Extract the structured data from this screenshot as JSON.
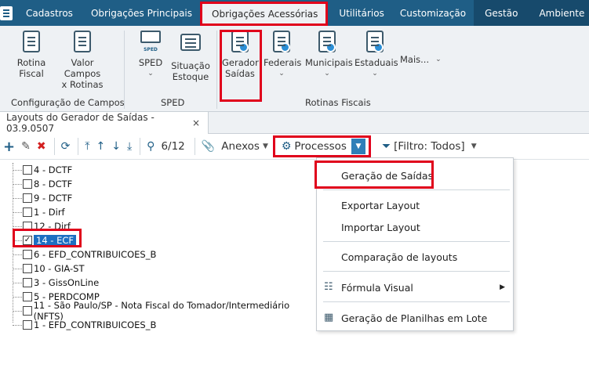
{
  "menubar": {
    "tabs": [
      {
        "label": "Cadastros"
      },
      {
        "label": "Obrigações Principais"
      },
      {
        "label": "Obrigações Acessórias"
      },
      {
        "label": "Utilitários"
      },
      {
        "label": "Customização"
      },
      {
        "label": "Gestão"
      },
      {
        "label": "Ambiente"
      }
    ]
  },
  "ribbon": {
    "buttons": [
      {
        "label": "Rotina\nFiscal",
        "line1": "Rotina",
        "line2": "Fiscal"
      },
      {
        "label": "Valor Campos x Rotinas",
        "line1": "Valor Campos",
        "line2": "x Rotinas"
      },
      {
        "label": "SPED",
        "line1": "SPED",
        "line2": ""
      },
      {
        "label": "Situação Estoque",
        "line1": "Situação",
        "line2": "Estoque"
      },
      {
        "label": "Gerador Saídas",
        "line1": "Gerador",
        "line2": "Saídas"
      },
      {
        "label": "Federais",
        "line1": "Federais",
        "line2": ""
      },
      {
        "label": "Municipais",
        "line1": "Municipais",
        "line2": ""
      },
      {
        "label": "Estaduais",
        "line1": "Estaduais",
        "line2": ""
      },
      {
        "label": "Mais...",
        "line1": "Mais...",
        "line2": ""
      }
    ],
    "groups": {
      "config": "Configuração de Campos",
      "sped": "SPED",
      "rotinas": "Rotinas Fiscais"
    },
    "sped_icon_text": "SPED"
  },
  "doc_tab": {
    "title": "Layouts do Gerador de Saídas - 03.9.0507",
    "close": "×"
  },
  "toolbar": {
    "counter": "6/12",
    "anexos": "Anexos",
    "processos": "Processos",
    "filtro": "[Filtro: Todos]"
  },
  "tree": {
    "items": [
      {
        "label": "4 - DCTF",
        "checked": false
      },
      {
        "label": "8 - DCTF",
        "checked": false
      },
      {
        "label": "9 - DCTF",
        "checked": false
      },
      {
        "label": "1 - Dirf",
        "checked": false
      },
      {
        "label": "12 - Dirf",
        "checked": false
      },
      {
        "label": "14 - ECF",
        "checked": true
      },
      {
        "label": "6 - EFD_CONTRIBUICOES_B",
        "checked": false
      },
      {
        "label": "10 - GIA-ST",
        "checked": false
      },
      {
        "label": "3 - GissOnLine",
        "checked": false
      },
      {
        "label": "5 - PERDCOMP",
        "checked": false
      },
      {
        "label": "11 - São Paulo/SP - Nota Fiscal do Tomador/Intermediário (NFTS)",
        "checked": false
      },
      {
        "label": "1 - EFD_CONTRIBUICOES_B",
        "checked": false
      }
    ],
    "check_mark": "✓"
  },
  "menu": {
    "items": [
      {
        "label": "Geração de Saídas"
      },
      {
        "label": "Exportar Layout"
      },
      {
        "label": "Importar Layout"
      },
      {
        "label": "Comparação de layouts"
      },
      {
        "label": "Fórmula Visual"
      },
      {
        "label": "Geração de Planilhas em Lote"
      }
    ]
  },
  "colors": {
    "menubar_bg": "#1f5e86",
    "highlight_red": "#e0001b",
    "selection_blue": "#1d6fc2"
  }
}
